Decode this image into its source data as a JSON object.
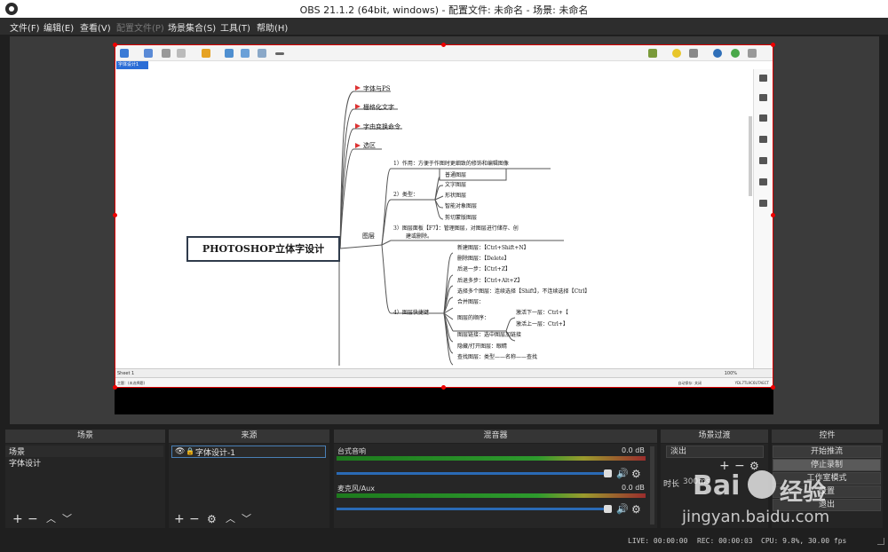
{
  "window": {
    "title": "OBS 21.1.2 (64bit, windows) - 配置文件: 未命名 - 场景: 未命名"
  },
  "menu": [
    "文件(F)",
    "编辑(E)",
    "查看(V)",
    "配置文件(P)",
    "场景集合(S)",
    "工具(T)",
    "帮助(H)"
  ],
  "xmind": {
    "tab": "字体设计1",
    "sheet": "Sheet 1",
    "status_left": "主题：(未选择题)",
    "status_right": "自动保存: 关闭",
    "status_user": "YDL7TL9C6UTAECT",
    "zoom": "100%",
    "central": "PHOTOSHOP立体字设计",
    "branches": [
      "字体与PS",
      "栅格化文字",
      "字由变换命令",
      "选区",
      "图层"
    ],
    "layer_items": {
      "use": "1）作用：方便于作图时更细致的修饰和编辑图像",
      "type": "2）类型：",
      "types": [
        "普通图层",
        "文字图层",
        "形状图层",
        "智能对象图层",
        "剪切蒙版图层"
      ],
      "panel": "3）图层面板【F7】：管理图层，对图层进行储存、创",
      "panel2": "建或删除。",
      "shortcuts": "4）图层快捷键",
      "shortcut_list": [
        "新建图层：【Ctrl+Shift+N】",
        "删除图层：【Delete】",
        "后退一步：【Ctrl+Z】",
        "后退多步：【Ctrl+Alt+Z】",
        "选择多个图层：连续选择【Shift】，不连续选择【Ctrl】",
        "合并图层：",
        "图层的顺序：",
        "图层链接：选中图层加链接",
        "隐藏/打开图层：眼睛",
        "查找图层：类型——名称——查找"
      ],
      "order": [
        "激活下一层：Ctrl+【",
        "激活上一层：Ctrl+】"
      ]
    }
  },
  "panels": {
    "scenes": {
      "title": "场景",
      "items": [
        "场景",
        "字体设计"
      ]
    },
    "sources": {
      "title": "来源",
      "items": [
        "字体设计-1"
      ]
    },
    "mixer": {
      "title": "混音器",
      "channels": [
        {
          "name": "台式音响",
          "db": "0.0 dB"
        },
        {
          "name": "麦克风/Aux",
          "db": "0.0 dB"
        }
      ]
    },
    "transitions": {
      "title": "场景过渡",
      "type": "淡出",
      "duration_label": "时长",
      "duration": "300ms"
    },
    "controls": {
      "title": "控件",
      "buttons": [
        "开始推流",
        "停止录制",
        "工作室模式",
        "设置",
        "退出"
      ]
    }
  },
  "status": {
    "live": "LIVE: 00:00:00",
    "rec": "REC: 00:00:03",
    "cpu": "CPU: 9.8%, 30.00 fps"
  },
  "watermark": {
    "brand": "Bai",
    "brand2": "经验",
    "url": "jingyan.baidu.com"
  },
  "colors": {
    "accent": "#2a6ab5",
    "preview_border": "#dd0000"
  }
}
